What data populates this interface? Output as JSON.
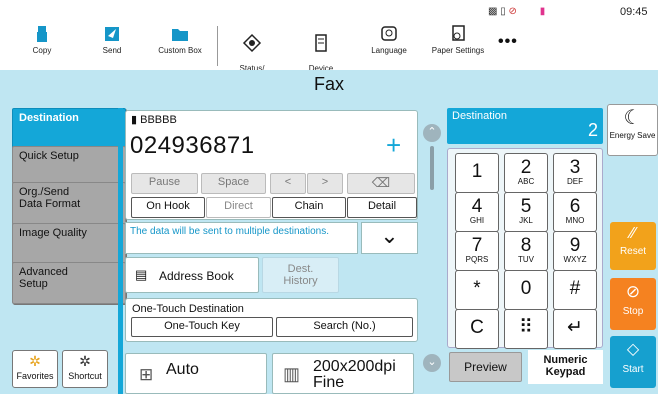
{
  "topbar": {
    "items": [
      {
        "label": "Copy",
        "icon": "copy-icon"
      },
      {
        "label": "Send",
        "icon": "send-icon"
      },
      {
        "label": "Custom Box",
        "icon": "folder-icon"
      },
      {
        "label": "Status/\nJob Cancel",
        "icon": "status-icon"
      },
      {
        "label": "Device\nInformation",
        "icon": "device-info-icon"
      },
      {
        "label": "Language",
        "icon": "language-icon"
      },
      {
        "label": "Paper Settings",
        "icon": "paper-settings-icon"
      }
    ],
    "more": "•••",
    "clock": "09:45"
  },
  "title": "Fax",
  "nav": [
    {
      "label": "Destination"
    },
    {
      "label": "Quick Setup"
    },
    {
      "label": "Org./Send\nData Format"
    },
    {
      "label": "Image Quality"
    },
    {
      "label": "Advanced\nSetup"
    }
  ],
  "favorites": "Favorites",
  "shortcut": "Shortcut",
  "entry": {
    "name": "BBBBB",
    "number": "024936871",
    "plus": "+",
    "pause": "Pause",
    "space": "Space",
    "left": "<",
    "right": ">",
    "backspace": "⌫",
    "on_hook": "On Hook",
    "direct": "Direct",
    "chain": "Chain",
    "detail": "Detail",
    "notice": "The data will be sent to multiple destinations.",
    "chevron": "⌄"
  },
  "address_book": "Address Book",
  "dest_history": "Dest.\nHistory",
  "one_touch": {
    "title": "One-Touch Destination",
    "key_btn": "One-Touch Key",
    "search_btn": "Search (No.)"
  },
  "bottom": {
    "auto": "Auto",
    "resolution": "200x200dpi\nFine"
  },
  "destination": {
    "label": "Destination",
    "count": "2"
  },
  "keypad": [
    {
      "d": "1",
      "l": ""
    },
    {
      "d": "2",
      "l": "ABC"
    },
    {
      "d": "3",
      "l": "DEF"
    },
    {
      "d": "4",
      "l": "GHI"
    },
    {
      "d": "5",
      "l": "JKL"
    },
    {
      "d": "6",
      "l": "MNO"
    },
    {
      "d": "7",
      "l": "PQRS"
    },
    {
      "d": "8",
      "l": "TUV"
    },
    {
      "d": "9",
      "l": "WXYZ"
    },
    {
      "d": "*",
      "l": ""
    },
    {
      "d": "0",
      "l": ""
    },
    {
      "d": "#",
      "l": ""
    },
    {
      "d": "C",
      "l": ""
    },
    {
      "d": "⠿",
      "l": ""
    },
    {
      "d": "↵",
      "l": ""
    }
  ],
  "preview": "Preview",
  "numeric_keypad": "Numeric\nKeypad",
  "right": {
    "energy": "Energy Save",
    "reset": "Reset",
    "stop": "Stop",
    "start": "Start"
  },
  "colors": {
    "accent": "#14a7d8",
    "reset": "#f2a21b",
    "stop": "#f58220",
    "start": "#16a0cf",
    "background": "#bfe6f2"
  }
}
